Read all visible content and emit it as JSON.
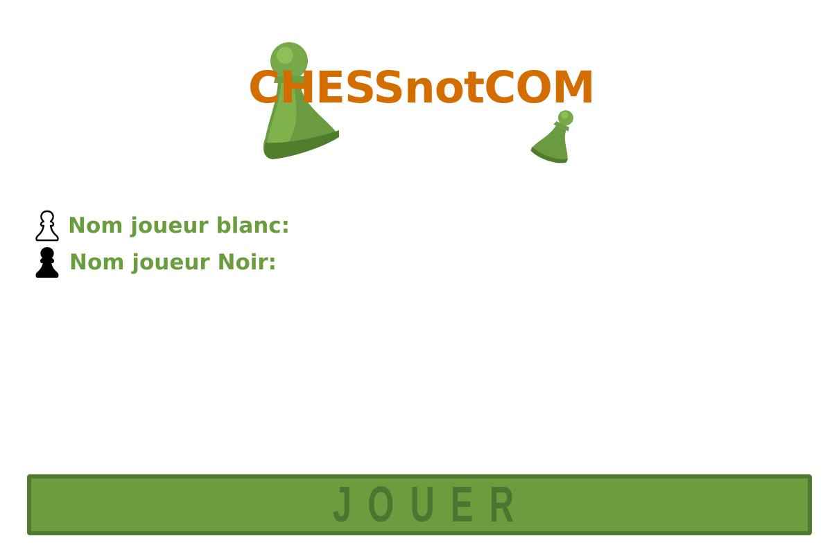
{
  "logo": {
    "text": "CHESSnotCOM",
    "icons": [
      "pawn-icon",
      "pawn-icon"
    ]
  },
  "players": {
    "white": {
      "icon": "white-pawn-icon",
      "label": "Nom joueur blanc:"
    },
    "black": {
      "icon": "black-pawn-icon",
      "label": "Nom joueur Noir:"
    }
  },
  "play_button": {
    "label": "JOUER"
  },
  "colors": {
    "logo_text": "#d36d00",
    "label_green": "#6a9d3d",
    "button_fill": "#6c9c3e",
    "button_border": "#4f7b30",
    "button_text": "#4b7530",
    "pawn_light": "#8bbb4c",
    "pawn_dark": "#5b8a2e"
  }
}
